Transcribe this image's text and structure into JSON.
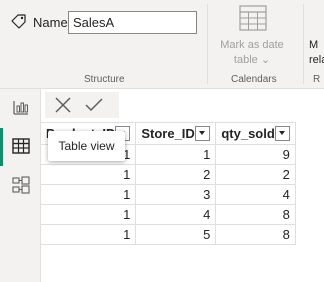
{
  "properties": {
    "name_label": "Name",
    "name_value": "SalesA",
    "group_label": "Structure"
  },
  "calendars": {
    "mark_line1": "Mark as date",
    "mark_line2": "table ⌄",
    "group_label": "Calendars",
    "next_line1": "M",
    "next_line2": "rela",
    "next_group": "R"
  },
  "views": {
    "report": "report-view-icon",
    "table": "table-view-icon",
    "model": "model-view-icon",
    "tooltip": "Table view"
  },
  "colors": {
    "accent": "#118d6f",
    "ribbon_bg": "#f3f2f1",
    "border": "#e1dfdd"
  },
  "table": {
    "columns": [
      "Product_ID",
      "Store_ID",
      "qty_sold"
    ],
    "rows": [
      [
        "1",
        "1",
        "9"
      ],
      [
        "1",
        "2",
        "2"
      ],
      [
        "1",
        "3",
        "4"
      ],
      [
        "1",
        "4",
        "8"
      ],
      [
        "1",
        "5",
        "8"
      ]
    ]
  }
}
